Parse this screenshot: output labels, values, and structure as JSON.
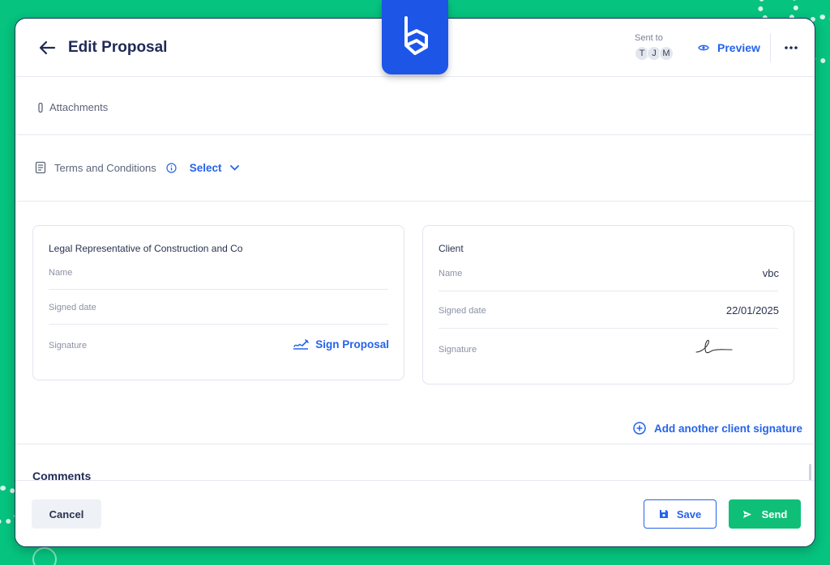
{
  "header": {
    "title": "Edit Proposal",
    "sent_to_label": "Sent to",
    "recipients": [
      "T",
      "J",
      "M"
    ],
    "preview_label": "Preview"
  },
  "attachments": {
    "label": "Attachments"
  },
  "terms": {
    "label": "Terms and Conditions",
    "select_label": "Select"
  },
  "legal_card": {
    "title": "Legal Representative of Construction and Co",
    "name_label": "Name",
    "name_value": "",
    "signed_date_label": "Signed date",
    "signed_date_value": "",
    "signature_label": "Signature",
    "sign_button_label": "Sign Proposal"
  },
  "client_card": {
    "title": "Client",
    "name_label": "Name",
    "name_value": "vbc",
    "signed_date_label": "Signed date",
    "signed_date_value": "22/01/2025",
    "signature_label": "Signature"
  },
  "add_signature_label": "Add another client signature",
  "comments": {
    "title": "Comments"
  },
  "footer": {
    "cancel_label": "Cancel",
    "save_label": "Save",
    "send_label": "Send"
  },
  "colors": {
    "accent": "#2563eb",
    "brand_green": "#0fbf77",
    "background": "#06c47f",
    "logo_blue": "#1d55e6"
  },
  "icons": {
    "back": "arrow-left-icon",
    "preview": "eye-icon",
    "more": "more-horizontal-icon",
    "attachments": "paperclip-icon",
    "terms": "document-icon",
    "info": "info-icon",
    "select": "chevron-down-icon",
    "sign": "signature-pen-icon",
    "add": "plus-circle-icon",
    "save": "floppy-disk-icon",
    "send": "send-icon",
    "logo": "cube-logo-icon"
  }
}
